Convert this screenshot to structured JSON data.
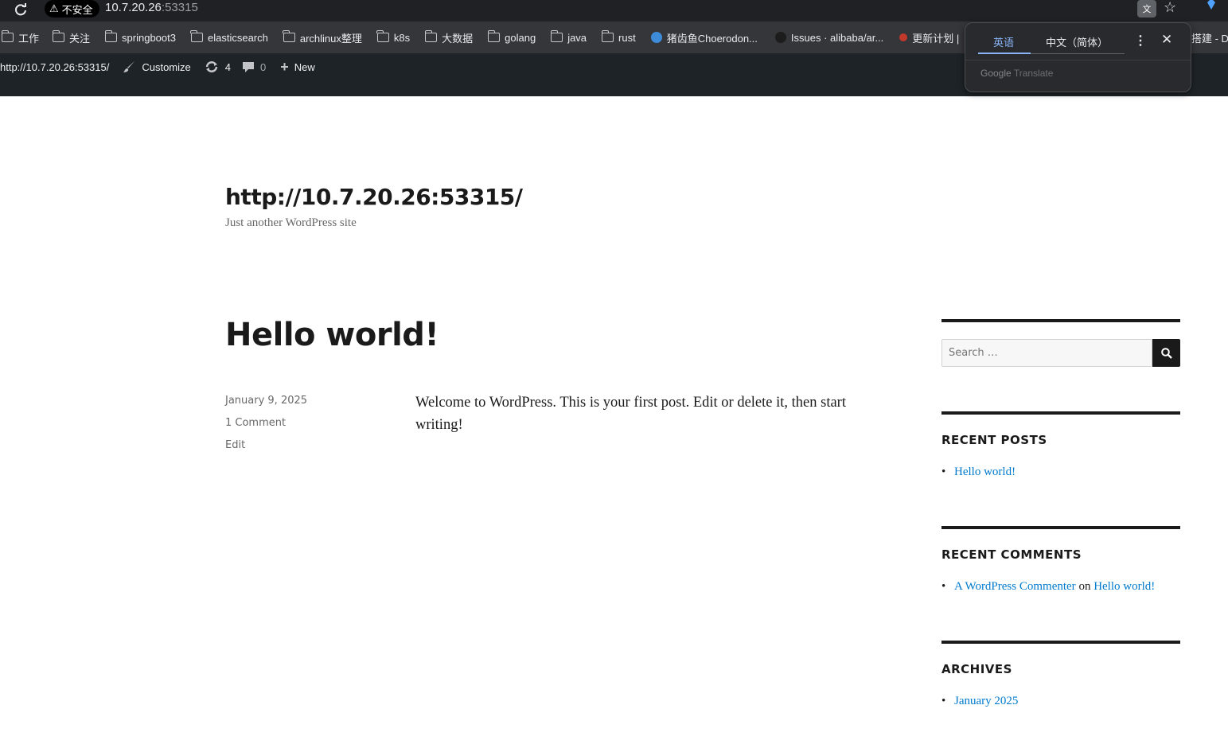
{
  "browser": {
    "security_label": "不安全",
    "url_host": "10.7.20.26",
    "url_port": ":53315",
    "bookmarks": [
      {
        "label": "工作",
        "icon": "folder-icon"
      },
      {
        "label": "关注",
        "icon": "folder-icon"
      },
      {
        "label": "springboot3",
        "icon": "folder-icon"
      },
      {
        "label": "elasticsearch",
        "icon": "folder-icon"
      },
      {
        "label": "archlinux整理",
        "icon": "folder-icon"
      },
      {
        "label": "k8s",
        "icon": "folder-icon"
      },
      {
        "label": "大数据",
        "icon": "folder-icon"
      },
      {
        "label": "golang",
        "icon": "folder-icon"
      },
      {
        "label": "java",
        "icon": "folder-icon"
      },
      {
        "label": "rust",
        "icon": "folder-icon"
      },
      {
        "label": "猪齿鱼Choerodon...",
        "icon": "choerodon-icon"
      },
      {
        "label": "Issues · alibaba/ar...",
        "icon": "github-icon"
      },
      {
        "label": "更新计划 |",
        "icon": "site-icon"
      },
      {
        "label": "搭建 - D",
        "icon": "none"
      }
    ]
  },
  "translate_popup": {
    "tab_source": "英语",
    "tab_target": "中文（简体）",
    "brand_google": "Google",
    "brand_translate": "Translate"
  },
  "admin_bar": {
    "site_link": "http://10.7.20.26:53315/",
    "customize": "Customize",
    "updates_count": "4",
    "comments_count": "0",
    "new_label": "New"
  },
  "site": {
    "title": "http://10.7.20.26:53315/",
    "description": "Just another WordPress site"
  },
  "post": {
    "title": "Hello world!",
    "date": "January 9, 2025",
    "comments": "1 Comment",
    "edit": "Edit",
    "content": "Welcome to WordPress. This is your first post. Edit or delete it, then start writing!"
  },
  "sidebar": {
    "search_placeholder": "Search …",
    "recent_posts_title": "RECENT POSTS",
    "recent_posts": [
      "Hello world!"
    ],
    "recent_comments_title": "RECENT COMMENTS",
    "recent_comment": {
      "author": "A WordPress Commenter",
      "on": "on",
      "post": "Hello world!"
    },
    "archives_title": "ARCHIVES",
    "archives": [
      "January 2025"
    ]
  },
  "colors": {
    "link": "#007acc",
    "admin_bar": "#1d2327",
    "text": "#1a1a1a"
  }
}
